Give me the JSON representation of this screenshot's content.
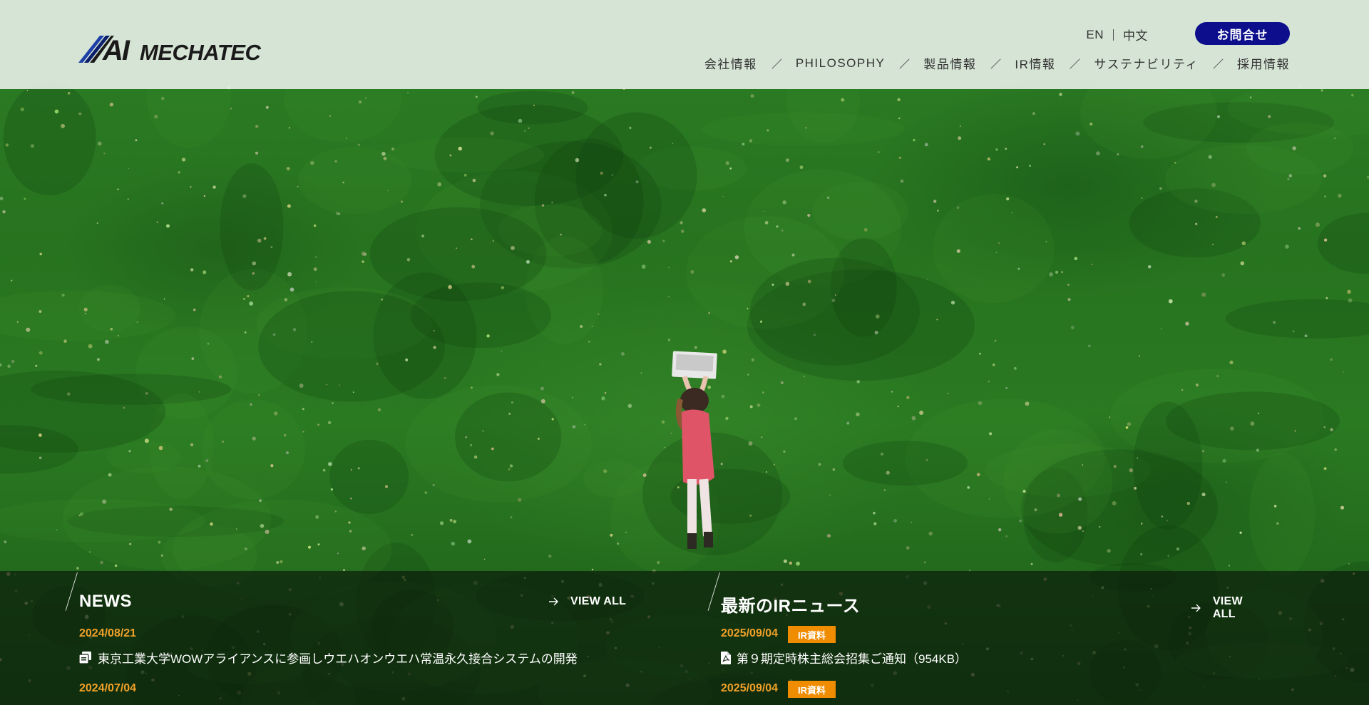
{
  "header": {
    "logo_text": "AIMECHATEC",
    "lang": {
      "en": "EN",
      "zh": "中文"
    },
    "contact_label": "お問合せ",
    "nav": [
      {
        "label": "会社情報"
      },
      {
        "label": "PHILOSOPHY"
      },
      {
        "label": "製品情報"
      },
      {
        "label": "IR情報"
      },
      {
        "label": "サステナビリティ"
      },
      {
        "label": "採用情報"
      }
    ]
  },
  "news": {
    "title": "NEWS",
    "view_all": "VIEW ALL",
    "items": [
      {
        "date": "2024/08/21",
        "title": "東京工業大学WOWアライアンスに参画しウエハオンウエハ常温永久接合システムの開発",
        "icon": "document-stack-icon"
      },
      {
        "date": "2024/07/04",
        "title": ""
      }
    ]
  },
  "ir_news": {
    "title": "最新のIRニュース",
    "view_all": "VIEW ALL",
    "items": [
      {
        "date": "2025/09/04",
        "badge": "IR資料",
        "title": "第９期定時株主総会招集ご通知（954KB）",
        "icon": "pdf-file-icon"
      },
      {
        "date": "2025/09/04",
        "badge": "IR資料",
        "title": ""
      }
    ]
  },
  "colors": {
    "brand_navy": "#0c0e8c",
    "date_orange": "#f0a028",
    "badge_orange": "#f08c00",
    "grass_green": "#2a7a22"
  }
}
